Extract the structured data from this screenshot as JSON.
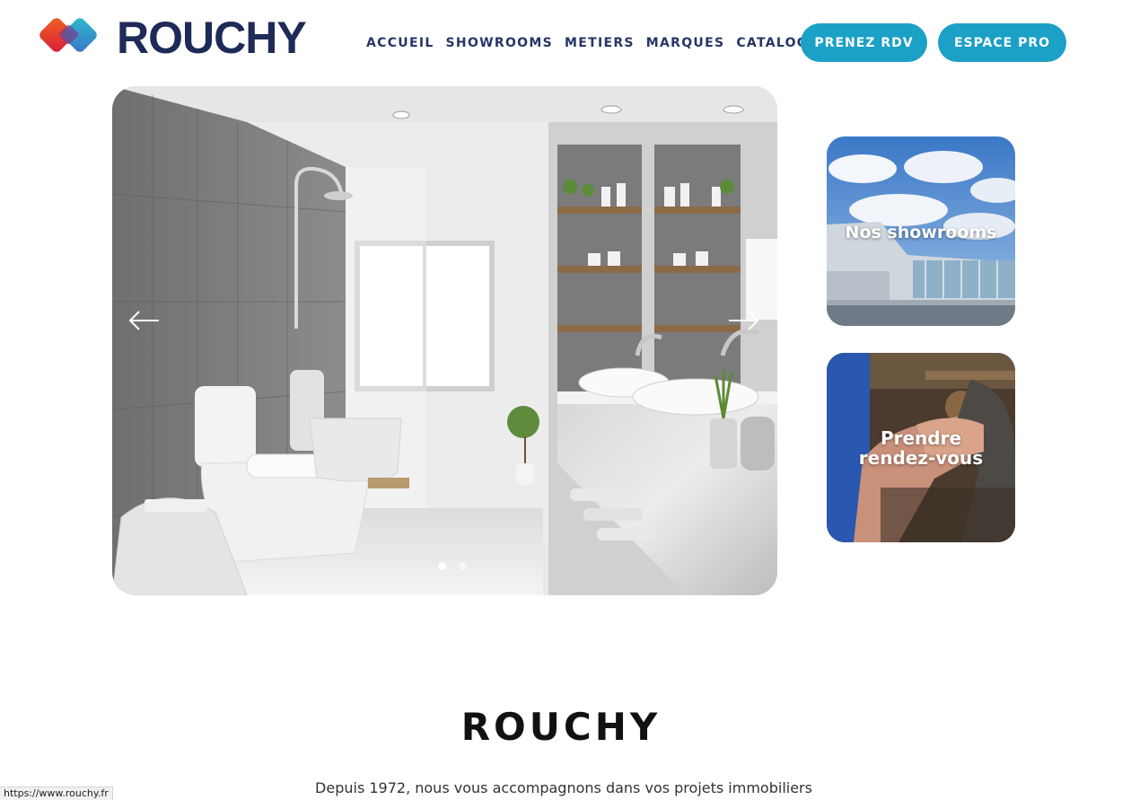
{
  "header": {
    "logo_text": "ROUCHY",
    "nav": [
      "ACCUEIL",
      "SHOWROOMS",
      "METIERS",
      "MARQUES",
      "CATALOGUES"
    ],
    "buttons": {
      "rdv": "PRENEZ RDV",
      "pro": "ESPACE PRO"
    }
  },
  "slider": {
    "prev_icon": "arrow-left-icon",
    "next_icon": "arrow-right-icon",
    "dots_count": 2,
    "active_dot": 0
  },
  "cards": {
    "showrooms": "Nos showrooms",
    "rdv_line1": "Prendre",
    "rdv_line2": "rendez-vous"
  },
  "intro": {
    "title": "ROUCHY",
    "text": "Depuis 1972, nous vous accompagnons dans vos projets immobiliers"
  },
  "status_bar": {
    "url": "https://www.rouchy.fr"
  },
  "colors": {
    "brand_navy": "#1e2a57",
    "accent": "#1ba0c6",
    "logo_orange": "#f0641e",
    "logo_red": "#d81b3c",
    "logo_teal": "#1fb8c8"
  }
}
